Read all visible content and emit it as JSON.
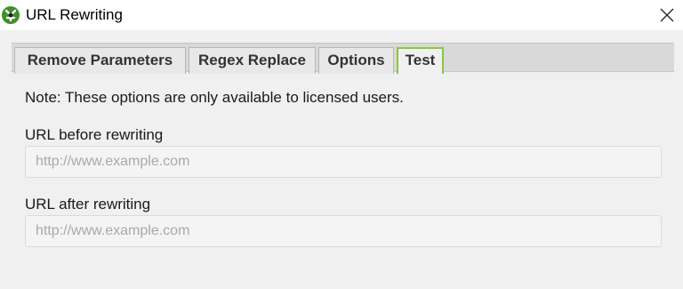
{
  "window": {
    "title": "URL Rewriting",
    "icon": "app-gear-icon",
    "close_icon": "close-icon"
  },
  "tabs": [
    {
      "label": "Remove Parameters",
      "active": false
    },
    {
      "label": "Regex Replace",
      "active": false
    },
    {
      "label": "Options",
      "active": false
    },
    {
      "label": "Test",
      "active": true
    }
  ],
  "test": {
    "note": "Note: These options are only available to licensed users.",
    "before": {
      "label": "URL before rewriting",
      "value": "",
      "placeholder": "http://www.example.com"
    },
    "after": {
      "label": "URL after rewriting",
      "value": "",
      "placeholder": "http://www.example.com"
    }
  },
  "colors": {
    "active_tab_border": "#8cc63f",
    "icon_green": "#3f8f2a"
  }
}
